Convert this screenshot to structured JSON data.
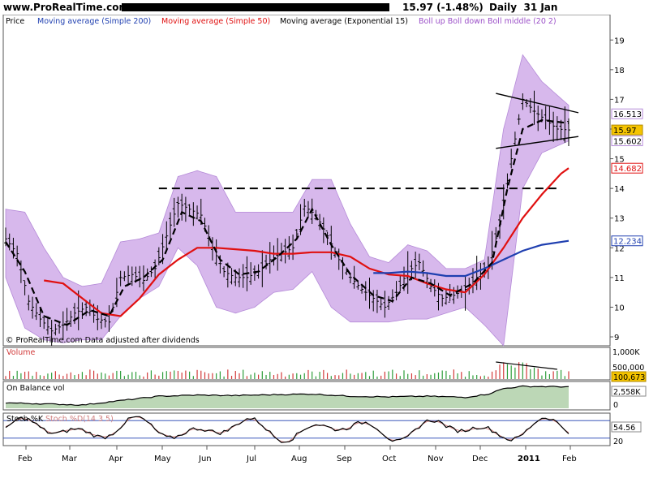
{
  "header": {
    "site": "www.ProRealTime.com",
    "quote": "15.97 (-1.48%)",
    "period": "Daily",
    "date": "31 Jan"
  },
  "legend": {
    "price": "Price",
    "ma200": "Moving average (Simple 200)",
    "ma50": "Moving average (Simple 50)",
    "ema15": "Moving average (Exponential 15)",
    "boll": "Boll up Boll down Boll middle (20 2)"
  },
  "watermark": "© ProRealTime.com  Data adjusted after dividends",
  "colors": {
    "ma200": "#1f3fb0",
    "ma50": "#e01010",
    "ema15": "#000000",
    "boll_fill": "#d7b8ec",
    "boll_line": "#b58ad8",
    "up_volume": "#2e9e3b",
    "down_volume": "#d23a3a",
    "obv_fill": "#bcd7b6",
    "stoch_k": "#000000",
    "stoch_d": "#d08080",
    "price_tag": "#f5c400"
  },
  "chart_data": [
    {
      "type": "line",
      "name": "price",
      "x_labels": [
        "Feb",
        "Mar",
        "Apr",
        "May",
        "Jun",
        "Jul",
        "Aug",
        "Sep",
        "Oct",
        "Nov",
        "Dec",
        "2011",
        "Feb"
      ],
      "ylim": [
        8.7,
        19.8
      ],
      "yticks": [
        9,
        10,
        11,
        12,
        13,
        14,
        15,
        16,
        17,
        18,
        19
      ],
      "price_close": [
        [
          0,
          12.3
        ],
        [
          3,
          11.8
        ],
        [
          6,
          10.2
        ],
        [
          9,
          9.6
        ],
        [
          12,
          9.2
        ],
        [
          15,
          9.4
        ],
        [
          18,
          9.8
        ],
        [
          21,
          10.0
        ],
        [
          24,
          9.6
        ],
        [
          27,
          9.5
        ],
        [
          30,
          11.0
        ],
        [
          33,
          11.1
        ],
        [
          36,
          10.9
        ],
        [
          39,
          11.3
        ],
        [
          42,
          12.4
        ],
        [
          45,
          13.5
        ],
        [
          48,
          13.3
        ],
        [
          51,
          13.1
        ],
        [
          54,
          12.0
        ],
        [
          57,
          11.2
        ],
        [
          60,
          11.0
        ],
        [
          63,
          11.0
        ],
        [
          66,
          11.2
        ],
        [
          69,
          11.6
        ],
        [
          72,
          11.8
        ],
        [
          75,
          12.0
        ],
        [
          78,
          13.4
        ],
        [
          81,
          13.1
        ],
        [
          84,
          12.4
        ],
        [
          87,
          11.6
        ],
        [
          90,
          11.0
        ],
        [
          93,
          10.6
        ],
        [
          96,
          10.3
        ],
        [
          99,
          10.0
        ],
        [
          102,
          10.5
        ],
        [
          105,
          11.2
        ],
        [
          108,
          11.5
        ],
        [
          111,
          10.7
        ],
        [
          114,
          10.3
        ],
        [
          117,
          10.4
        ],
        [
          120,
          10.6
        ],
        [
          123,
          11.0
        ],
        [
          126,
          11.4
        ],
        [
          129,
          12.8
        ],
        [
          132,
          15.0
        ],
        [
          135,
          17.0
        ],
        [
          138,
          16.6
        ],
        [
          141,
          16.3
        ],
        [
          144,
          16.0
        ],
        [
          147,
          15.97
        ]
      ],
      "ema15": [
        [
          0,
          12.2
        ],
        [
          5,
          11.2
        ],
        [
          10,
          9.7
        ],
        [
          16,
          9.4
        ],
        [
          22,
          9.9
        ],
        [
          27,
          9.7
        ],
        [
          31,
          10.7
        ],
        [
          36,
          11.0
        ],
        [
          41,
          11.6
        ],
        [
          46,
          13.2
        ],
        [
          51,
          12.9
        ],
        [
          56,
          11.6
        ],
        [
          61,
          11.1
        ],
        [
          66,
          11.2
        ],
        [
          71,
          11.7
        ],
        [
          76,
          12.3
        ],
        [
          80,
          13.3
        ],
        [
          85,
          12.1
        ],
        [
          90,
          11.1
        ],
        [
          96,
          10.4
        ],
        [
          101,
          10.2
        ],
        [
          106,
          11.0
        ],
        [
          111,
          10.8
        ],
        [
          116,
          10.4
        ],
        [
          122,
          10.8
        ],
        [
          127,
          11.5
        ],
        [
          131,
          14.0
        ],
        [
          135,
          16.0
        ],
        [
          140,
          16.3
        ],
        [
          147,
          16.2
        ]
      ],
      "ma50": [
        [
          10,
          10.9
        ],
        [
          15,
          10.8
        ],
        [
          20,
          10.3
        ],
        [
          25,
          9.8
        ],
        [
          30,
          9.7
        ],
        [
          35,
          10.3
        ],
        [
          40,
          11.1
        ],
        [
          45,
          11.6
        ],
        [
          50,
          12.0
        ],
        [
          55,
          12.0
        ],
        [
          60,
          11.95
        ],
        [
          65,
          11.9
        ],
        [
          70,
          11.8
        ],
        [
          75,
          11.8
        ],
        [
          80,
          11.85
        ],
        [
          85,
          11.85
        ],
        [
          90,
          11.7
        ],
        [
          95,
          11.3
        ],
        [
          100,
          11.1
        ],
        [
          105,
          11.05
        ],
        [
          110,
          10.8
        ],
        [
          115,
          10.6
        ],
        [
          120,
          10.5
        ],
        [
          125,
          11.1
        ],
        [
          130,
          12.0
        ],
        [
          135,
          13.0
        ],
        [
          140,
          13.8
        ],
        [
          145,
          14.5
        ],
        [
          147,
          14.682
        ]
      ],
      "ma200": [
        [
          96,
          11.15
        ],
        [
          100,
          11.15
        ],
        [
          105,
          11.2
        ],
        [
          110,
          11.15
        ],
        [
          115,
          11.05
        ],
        [
          120,
          11.05
        ],
        [
          125,
          11.3
        ],
        [
          130,
          11.6
        ],
        [
          135,
          11.9
        ],
        [
          140,
          12.1
        ],
        [
          147,
          12.234
        ]
      ],
      "boll_upper": [
        [
          0,
          13.3
        ],
        [
          5,
          13.2
        ],
        [
          10,
          12.0
        ],
        [
          15,
          11.0
        ],
        [
          20,
          10.7
        ],
        [
          25,
          10.8
        ],
        [
          30,
          12.2
        ],
        [
          35,
          12.3
        ],
        [
          40,
          12.5
        ],
        [
          45,
          14.4
        ],
        [
          50,
          14.6
        ],
        [
          55,
          14.4
        ],
        [
          60,
          13.2
        ],
        [
          65,
          13.2
        ],
        [
          70,
          13.2
        ],
        [
          75,
          13.2
        ],
        [
          80,
          14.3
        ],
        [
          85,
          14.3
        ],
        [
          90,
          12.8
        ],
        [
          95,
          11.7
        ],
        [
          100,
          11.5
        ],
        [
          105,
          12.1
        ],
        [
          110,
          11.9
        ],
        [
          115,
          11.3
        ],
        [
          120,
          11.3
        ],
        [
          125,
          11.6
        ],
        [
          130,
          16.0
        ],
        [
          135,
          18.5
        ],
        [
          140,
          17.6
        ],
        [
          147,
          16.8
        ]
      ],
      "boll_lower": [
        [
          0,
          11.0
        ],
        [
          5,
          9.3
        ],
        [
          10,
          8.9
        ],
        [
          15,
          8.8
        ],
        [
          20,
          8.9
        ],
        [
          25,
          8.9
        ],
        [
          30,
          9.7
        ],
        [
          35,
          10.3
        ],
        [
          40,
          10.7
        ],
        [
          45,
          12.0
        ],
        [
          50,
          11.4
        ],
        [
          55,
          10.0
        ],
        [
          60,
          9.8
        ],
        [
          65,
          10.0
        ],
        [
          70,
          10.5
        ],
        [
          75,
          10.6
        ],
        [
          80,
          11.2
        ],
        [
          85,
          10.0
        ],
        [
          90,
          9.5
        ],
        [
          95,
          9.5
        ],
        [
          100,
          9.5
        ],
        [
          105,
          9.6
        ],
        [
          110,
          9.6
        ],
        [
          115,
          9.8
        ],
        [
          120,
          10.0
        ],
        [
          125,
          9.4
        ],
        [
          130,
          8.7
        ],
        [
          135,
          14.0
        ],
        [
          140,
          15.2
        ],
        [
          147,
          15.6
        ]
      ],
      "annotations": {
        "resistance": 14.0,
        "triangle_top": [
          [
            128,
            17.2
          ],
          [
            147,
            16.55
          ]
        ],
        "triangle_bottom": [
          [
            128,
            15.35
          ],
          [
            147,
            15.75
          ]
        ]
      },
      "right_labels": [
        {
          "value": 16.513,
          "text": "16.513"
        },
        {
          "value": 15.97,
          "text": "15.97"
        },
        {
          "value": 15.602,
          "text": "15.602"
        },
        {
          "value": 14.682,
          "text": "14.682"
        },
        {
          "value": 12.234,
          "text": "12.234"
        }
      ]
    },
    {
      "type": "bar",
      "name": "volume",
      "title": "Volume",
      "yticks": [
        "1,000K",
        "500,000"
      ],
      "last_value": "100,673",
      "ymax": 1000
    },
    {
      "type": "area",
      "name": "on_balance_volume",
      "title": "On Balance vol",
      "yticks": [
        "2,558K",
        "0"
      ],
      "values": [
        [
          0,
          0.25
        ],
        [
          10,
          0.2
        ],
        [
          20,
          0.15
        ],
        [
          30,
          0.35
        ],
        [
          40,
          0.55
        ],
        [
          50,
          0.6
        ],
        [
          60,
          0.58
        ],
        [
          70,
          0.62
        ],
        [
          80,
          0.65
        ],
        [
          90,
          0.55
        ],
        [
          100,
          0.52
        ],
        [
          110,
          0.55
        ],
        [
          120,
          0.5
        ],
        [
          126,
          0.65
        ],
        [
          130,
          0.9
        ],
        [
          135,
          1.0
        ],
        [
          147,
          0.98
        ]
      ]
    },
    {
      "type": "line",
      "name": "stochastic",
      "title": "Stoch %K",
      "subtitle": "Stoch %D(14 3 5)",
      "ylim": [
        0,
        100
      ],
      "bands": [
        20,
        80
      ],
      "last_value": "54.56",
      "last_value_2": "20"
    }
  ]
}
